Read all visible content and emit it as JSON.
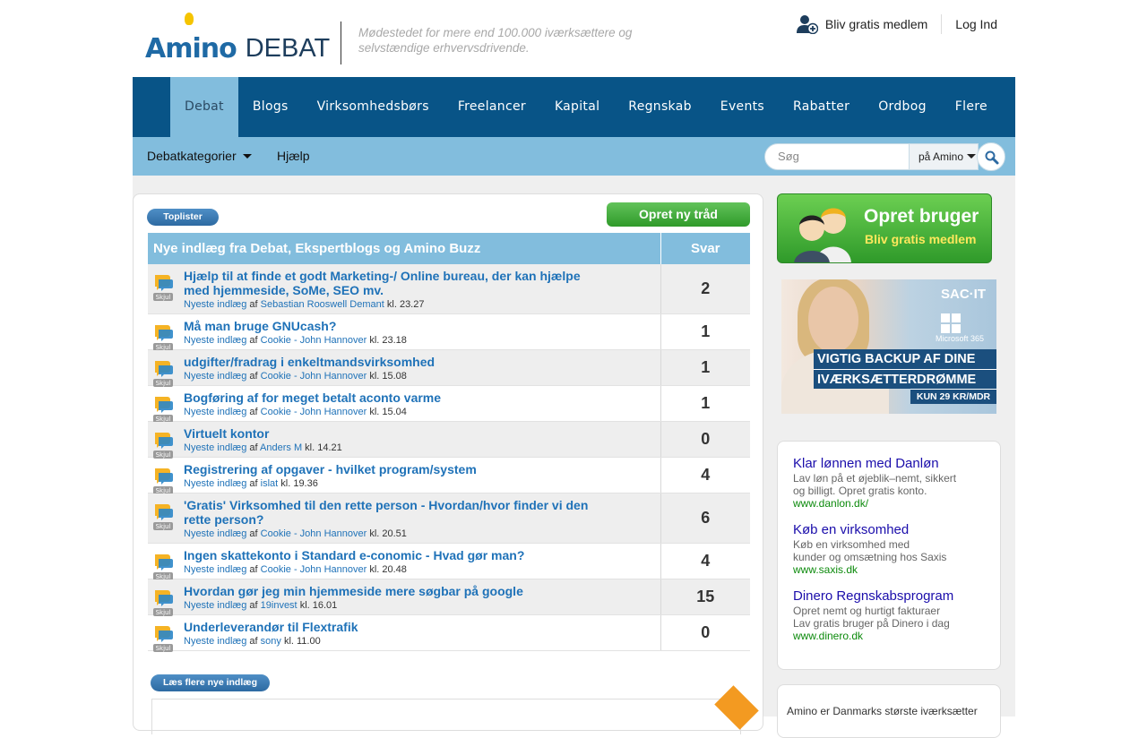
{
  "header": {
    "logo_text": "Amino",
    "section": "DEBAT",
    "tagline": "Mødestedet for mere end 100.000 iværksættere og selvstændige erhvervsdrivende.",
    "signup_label": "Bliv gratis medlem",
    "login_label": "Log Ind"
  },
  "nav": {
    "items": [
      "Debat",
      "Blogs",
      "Virksomhedsbørs",
      "Freelancer",
      "Kapital",
      "Regnskab",
      "Events",
      "Rabatter",
      "Ordbog",
      "Flere"
    ],
    "active": "Debat"
  },
  "subnav": {
    "categories_label": "Debatkategorier",
    "help_label": "Hjælp",
    "search_placeholder": "Søg",
    "search_scope": "på Amino"
  },
  "main": {
    "toplister_label": "Toplister",
    "create_thread_label": "Opret ny tråd",
    "table_header": "Nye indlæg fra Debat, Ekspertblogs og Amino Buzz",
    "replies_header": "Svar",
    "hide_label": "Skjul",
    "newest_label": "Nyeste indlæg",
    "by_label": "af",
    "threads": [
      {
        "title": "Hjælp til at finde et godt Marketing-/ Online bureau, der kan hjælpe med hjemmeside, SoMe, SEO mv.",
        "author": "Sebastian Rooswell Demant",
        "time": "kl. 23.27",
        "replies": "2"
      },
      {
        "title": "Må man bruge GNUcash?",
        "author": "Cookie - John Hannover",
        "time": "kl. 23.18",
        "replies": "1"
      },
      {
        "title": "udgifter/fradrag i enkeltmandsvirksomhed",
        "author": "Cookie - John Hannover",
        "time": "kl. 15.08",
        "replies": "1"
      },
      {
        "title": "Bogføring af for meget betalt aconto varme",
        "author": "Cookie - John Hannover",
        "time": "kl. 15.04",
        "replies": "1"
      },
      {
        "title": "Virtuelt kontor",
        "author": "Anders M",
        "time": "kl. 14.21",
        "replies": "0"
      },
      {
        "title": "Registrering af opgaver - hvilket program/system",
        "author": "islat",
        "time": "kl. 19.36",
        "replies": "4"
      },
      {
        "title": "'Gratis' Virksomhed til den rette person - Hvordan/hvor finder vi den rette person?",
        "author": "Cookie - John Hannover",
        "time": "kl. 20.51",
        "replies": "6"
      },
      {
        "title": "Ingen skattekonto i Standard e-conomic - Hvad gør man?",
        "author": "Cookie - John Hannover",
        "time": "kl. 20.48",
        "replies": "4"
      },
      {
        "title": "Hvordan gør jeg min hjemmeside mere søgbar på google",
        "author": "19invest",
        "time": "kl. 16.01",
        "replies": "15"
      },
      {
        "title": "Underleverandør til Flextrafik",
        "author": "sony",
        "time": "kl. 11.00",
        "replies": "0"
      }
    ],
    "more_label": "Læs flere nye indlæg"
  },
  "sidebar": {
    "promo_title": "Opret bruger",
    "promo_sub": "Bliv gratis medlem",
    "banner": {
      "brand": "SAC·IT",
      "product": "Microsoft 365",
      "line1": "VIGTIG BACKUP AF DINE",
      "line2": "IVÆRKSÆTTERDRØMME",
      "price": "KUN 29 KR/MDR"
    },
    "text_ads": [
      {
        "title": "Klar lønnen med Danløn",
        "desc1": "Lav løn på et øjeblik–nemt, sikkert",
        "desc2": "og billigt. Opret gratis konto.",
        "url": "www.danlon.dk/"
      },
      {
        "title": "Køb en virksomhed",
        "desc1": "Køb en virksomhed med",
        "desc2": "kunder og omsætning hos Saxis",
        "url": "www.saxis.dk"
      },
      {
        "title": "Dinero Regnskabsprogram",
        "desc1": "Opret nemt og hurtigt fakturaer",
        "desc2": "Lav gratis bruger på Dinero i dag",
        "url": "www.dinero.dk"
      }
    ],
    "about_text": "Amino er Danmarks største iværksætter"
  },
  "colors": {
    "nav_bg": "#085487",
    "subnav_bg": "#82bddd",
    "link": "#1f72b8",
    "create_green": "#2f9a2a"
  }
}
